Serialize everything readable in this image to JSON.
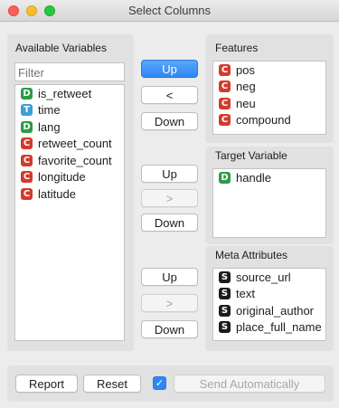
{
  "window": {
    "title": "Select Columns"
  },
  "available": {
    "title": "Available Variables",
    "filter_placeholder": "Filter",
    "items": [
      {
        "type": "D",
        "label": "is_retweet"
      },
      {
        "type": "T",
        "label": "time"
      },
      {
        "type": "D",
        "label": "lang"
      },
      {
        "type": "C",
        "label": "retweet_count"
      },
      {
        "type": "C",
        "label": "favorite_count"
      },
      {
        "type": "C",
        "label": "longitude"
      },
      {
        "type": "C",
        "label": "latitude"
      }
    ]
  },
  "features": {
    "title": "Features",
    "items": [
      {
        "type": "C",
        "label": "pos"
      },
      {
        "type": "C",
        "label": "neg"
      },
      {
        "type": "C",
        "label": "neu"
      },
      {
        "type": "C",
        "label": "compound"
      }
    ],
    "buttons": {
      "up": "Up",
      "move": "<",
      "down": "Down"
    }
  },
  "target": {
    "title": "Target Variable",
    "items": [
      {
        "type": "D",
        "label": "handle"
      }
    ],
    "buttons": {
      "up": "Up",
      "move": ">",
      "down": "Down"
    }
  },
  "meta": {
    "title": "Meta Attributes",
    "items": [
      {
        "type": "S",
        "label": "source_url"
      },
      {
        "type": "S",
        "label": "text"
      },
      {
        "type": "S",
        "label": "original_author"
      },
      {
        "type": "S",
        "label": "place_full_name"
      }
    ],
    "buttons": {
      "up": "Up",
      "move": ">",
      "down": "Down"
    }
  },
  "footer": {
    "report": "Report",
    "reset": "Reset",
    "auto_send_checked": true,
    "checkmark": "✓",
    "send": "Send Automatically"
  }
}
